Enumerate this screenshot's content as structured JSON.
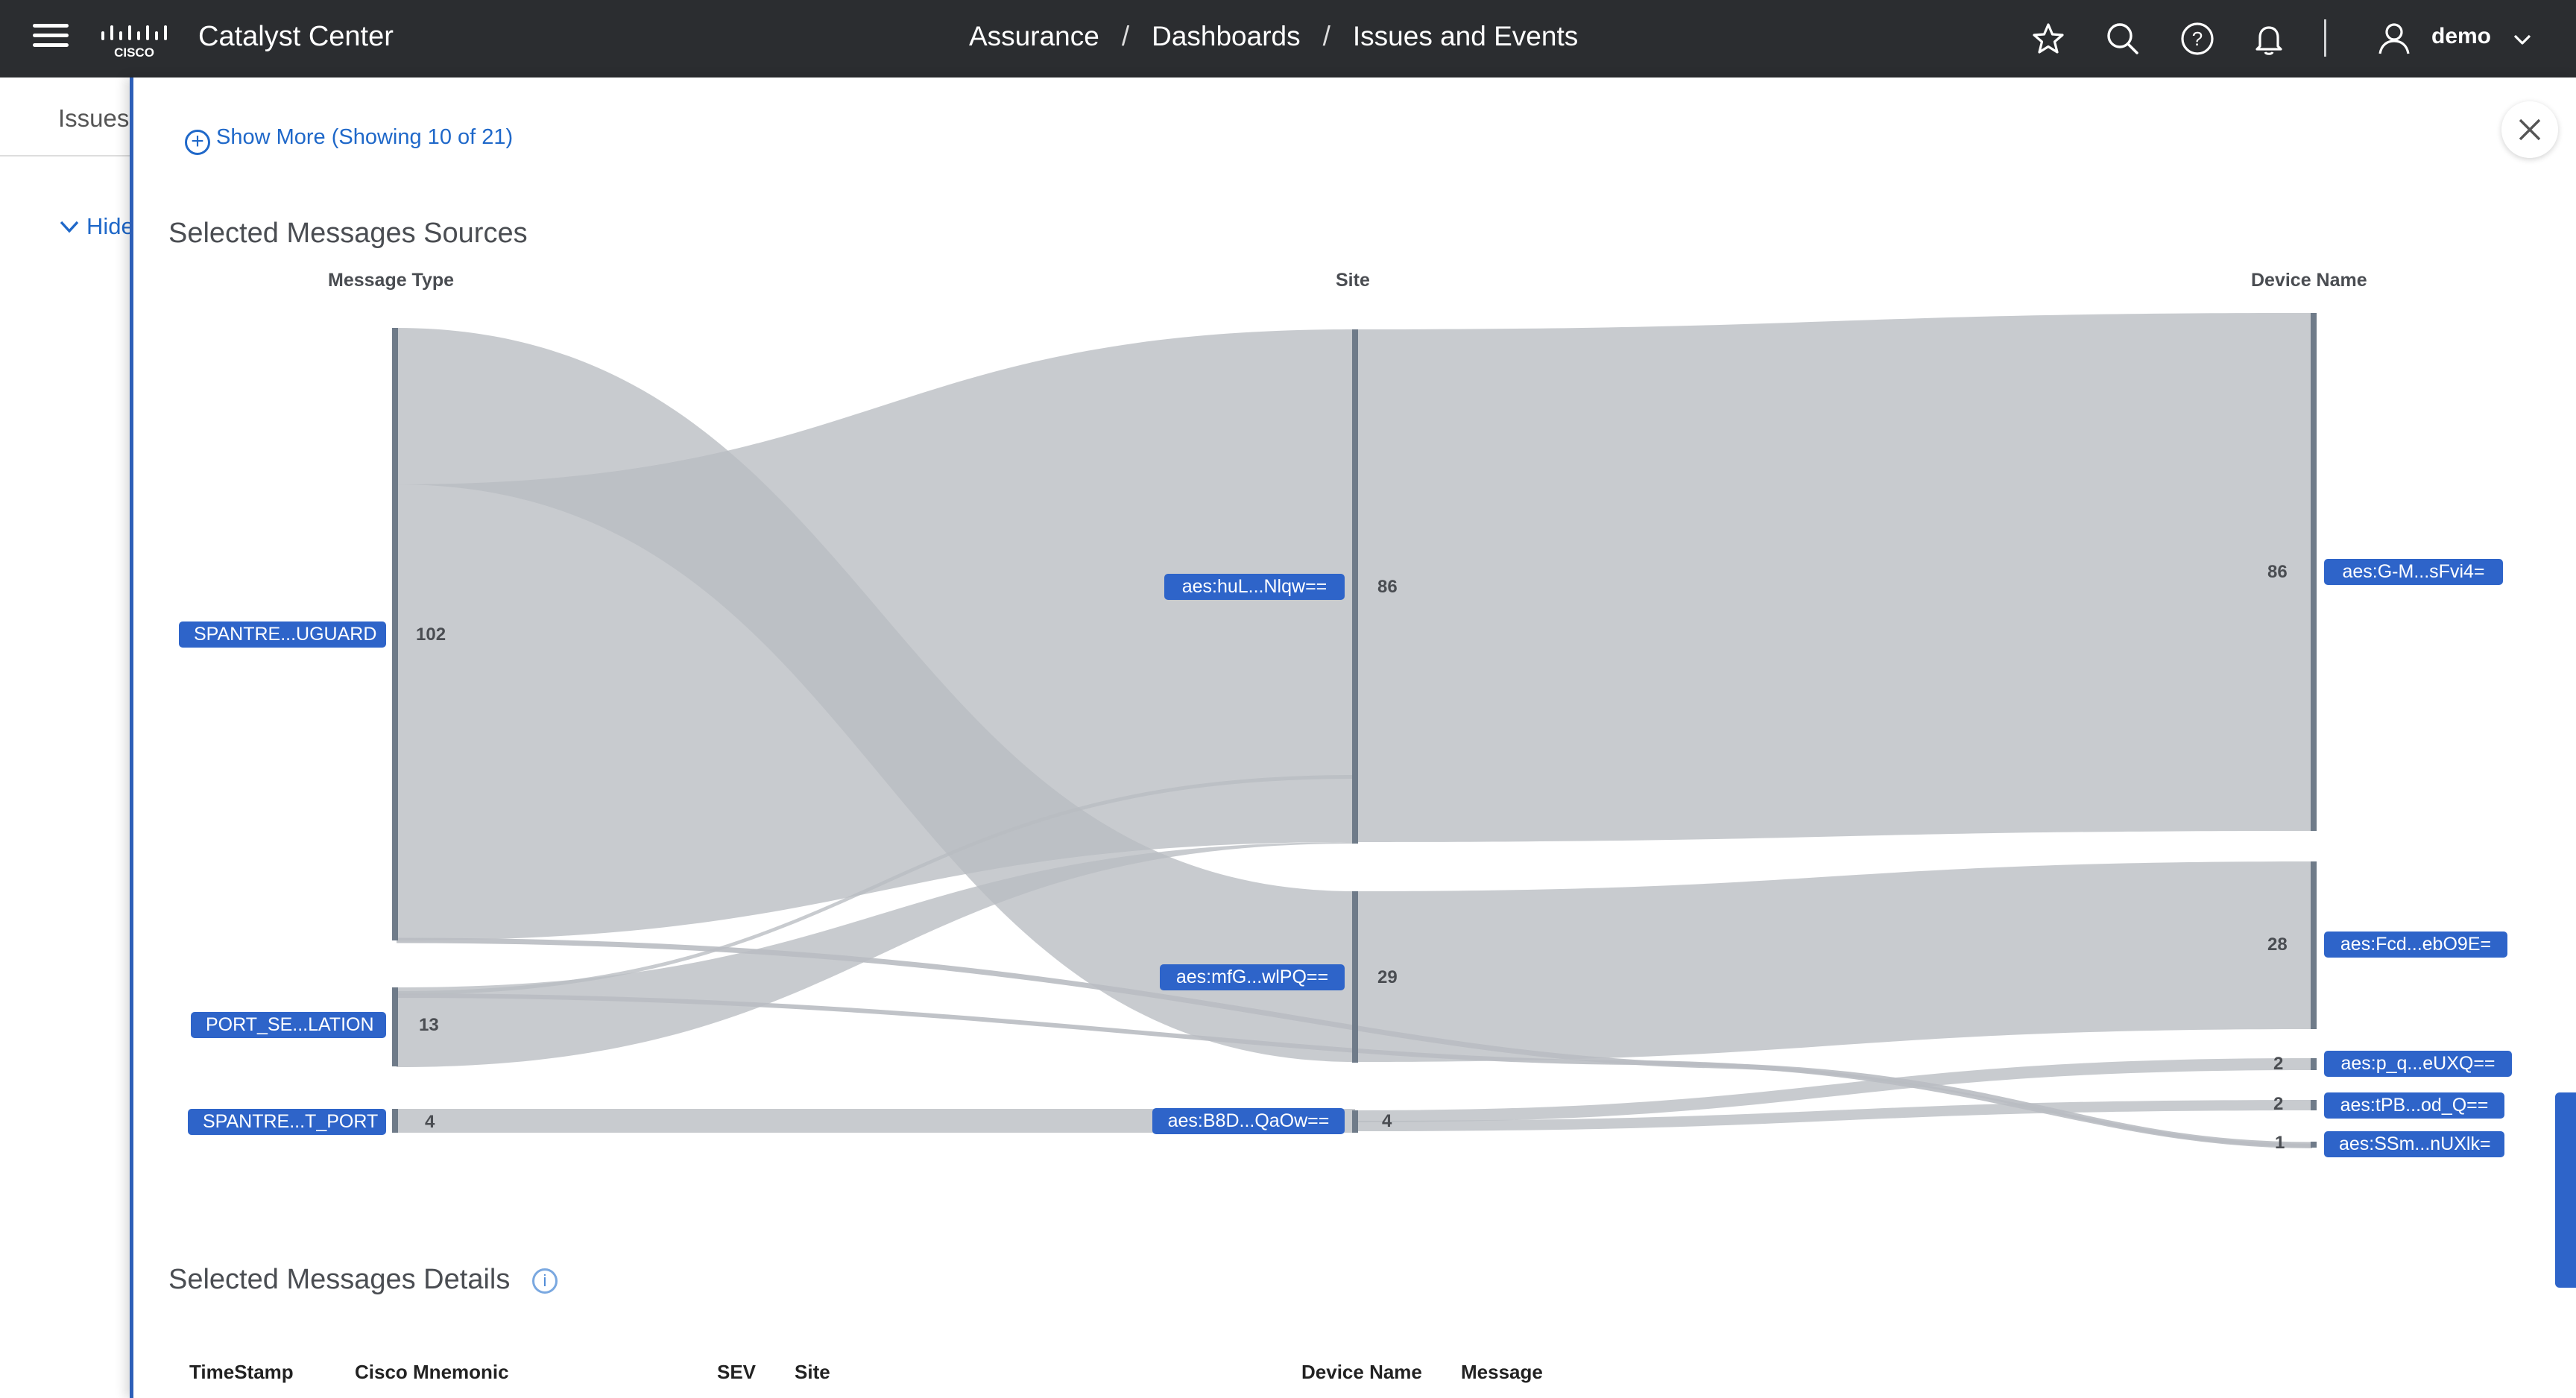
{
  "header": {
    "app_title": "Catalyst Center",
    "breadcrumb": [
      "Assurance",
      "Dashboards",
      "Issues and Events"
    ],
    "separator": "/",
    "user": "demo",
    "icons": [
      "menu-icon",
      "cisco-logo",
      "star-icon",
      "search-icon",
      "help-icon",
      "bell-icon",
      "user-icon",
      "chevron-down-icon"
    ]
  },
  "background_page": {
    "tab_label": "Issues",
    "hide_label": "Hide"
  },
  "drawer": {
    "show_more": "Show More (Showing 10 of 21)",
    "sources_title": "Selected Messages Sources",
    "details_title": "Selected Messages Details",
    "columns": [
      "Message Type",
      "Site",
      "Device Name"
    ],
    "message_types": [
      {
        "label": "SPANTRE...UGUARD",
        "count": "102"
      },
      {
        "label": "PORT_SE...LATION",
        "count": "13"
      },
      {
        "label": "SPANTRE...T_PORT",
        "count": "4"
      }
    ],
    "sites": [
      {
        "label": "aes:huL...Nlqw==",
        "count": "86"
      },
      {
        "label": "aes:mfG...wlPQ==",
        "count": "29"
      },
      {
        "label": "aes:B8D...QaOw==",
        "count": "4"
      }
    ],
    "devices": [
      {
        "label": "aes:G-M...sFvi4=",
        "count": "86"
      },
      {
        "label": "aes:Fcd...ebO9E=",
        "count": "28"
      },
      {
        "label": "aes:p_q...eUXQ==",
        "count": "2"
      },
      {
        "label": "aes:tPB...od_Q==",
        "count": "2"
      },
      {
        "label": "aes:SSm...nUXlk=",
        "count": "1"
      }
    ],
    "table_headers": [
      "TimeStamp",
      "Cisco Mnemonic",
      "SEV",
      "Site",
      "Device Name",
      "Message"
    ]
  }
}
